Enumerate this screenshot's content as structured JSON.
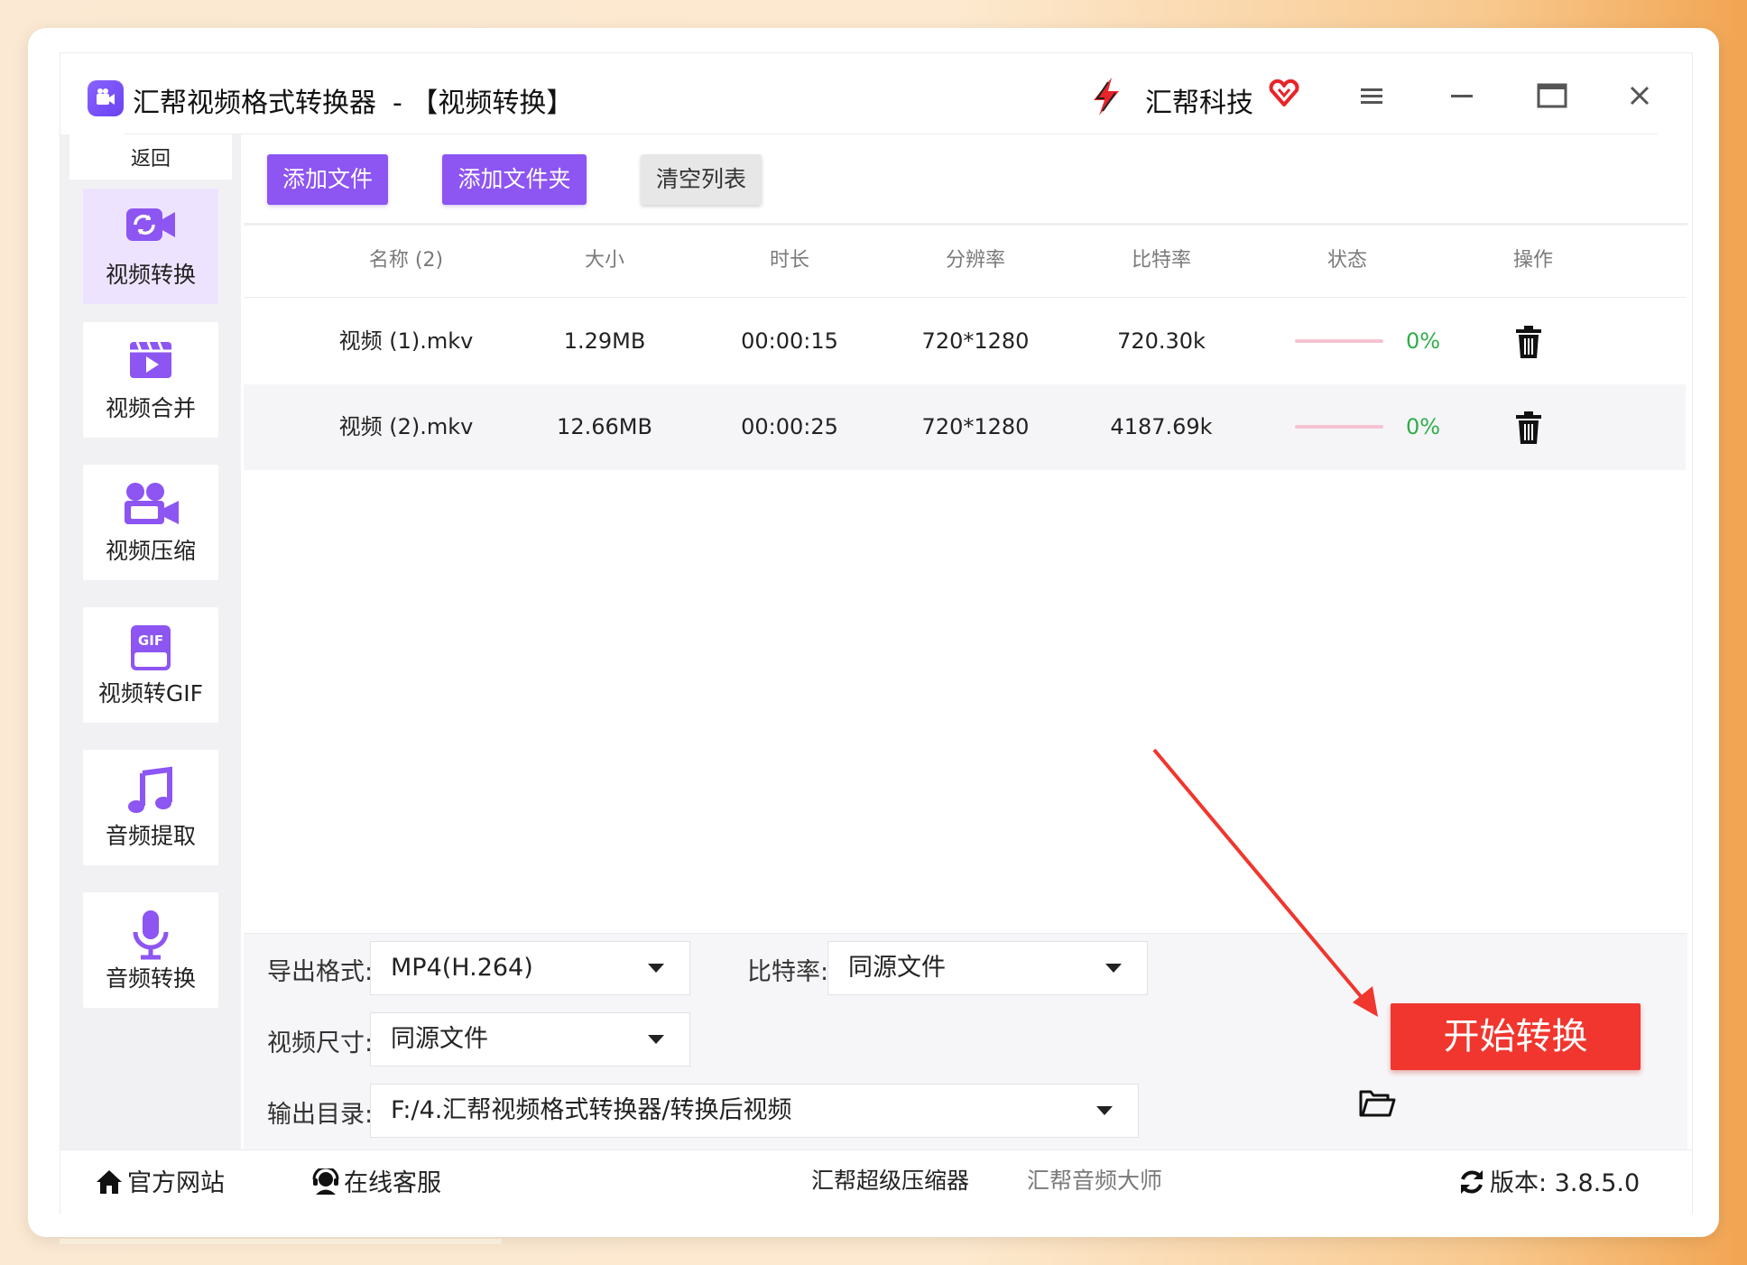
{
  "title_bar": {
    "app_title": "汇帮视频格式转换器",
    "mode_label": "-  【视频转换】",
    "brand_name": "汇帮科技",
    "icons": [
      "app-logo-icon",
      "brand-logo-icon",
      "vip-heart-icon",
      "menu-icon",
      "minimize-icon",
      "maximize-icon",
      "close-icon"
    ]
  },
  "sidebar": {
    "back_label": "返回",
    "items": [
      {
        "label": "视频转换",
        "icon": "video-convert-icon",
        "active": true
      },
      {
        "label": "视频合并",
        "icon": "video-merge-icon",
        "active": false
      },
      {
        "label": "视频压缩",
        "icon": "video-compress-icon",
        "active": false
      },
      {
        "label": "视频转GIF",
        "icon": "gif-icon",
        "active": false
      },
      {
        "label": "音频提取",
        "icon": "music-note-icon",
        "active": false
      },
      {
        "label": "音频转换",
        "icon": "microphone-icon",
        "active": false
      }
    ]
  },
  "toolbar": {
    "add_file": "添加文件",
    "add_folder": "添加文件夹",
    "clear_list": "清空列表"
  },
  "table": {
    "headers": [
      "名称 (2)",
      "大小",
      "时长",
      "分辨率",
      "比特率",
      "状态",
      "操作"
    ],
    "rows": [
      {
        "name": "视频 (1).mkv",
        "size": "1.29MB",
        "duration": "00:00:15",
        "resolution": "720*1280",
        "bitrate": "720.30k",
        "progress": 0,
        "status": "0%"
      },
      {
        "name": "视频 (2).mkv",
        "size": "12.66MB",
        "duration": "00:00:25",
        "resolution": "720*1280",
        "bitrate": "4187.69k",
        "progress": 0,
        "status": "0%"
      }
    ]
  },
  "settings": {
    "format_label": "导出格式:",
    "format_value": "MP4(H.264)",
    "bitrate_label": "比特率:",
    "bitrate_value": "同源文件",
    "size_label": "视频尺寸:",
    "size_value": "同源文件",
    "output_label": "输出目录:",
    "output_value": "F:/4.汇帮视频格式转换器/转换后视频",
    "start_button": "开始转换"
  },
  "footer": {
    "official_site": "官方网站",
    "online_service": "在线客服",
    "compressor": "汇帮超级压缩器",
    "audio_master": "汇帮音频大师",
    "version": "版本:  3.8.5.0"
  },
  "colors": {
    "accent_purple": "#8d55f2",
    "start_red": "#f0362e",
    "status_green": "#2fae4a",
    "progress_pink": "#f5c3d1",
    "sidebar_active": "#ede3ff"
  }
}
